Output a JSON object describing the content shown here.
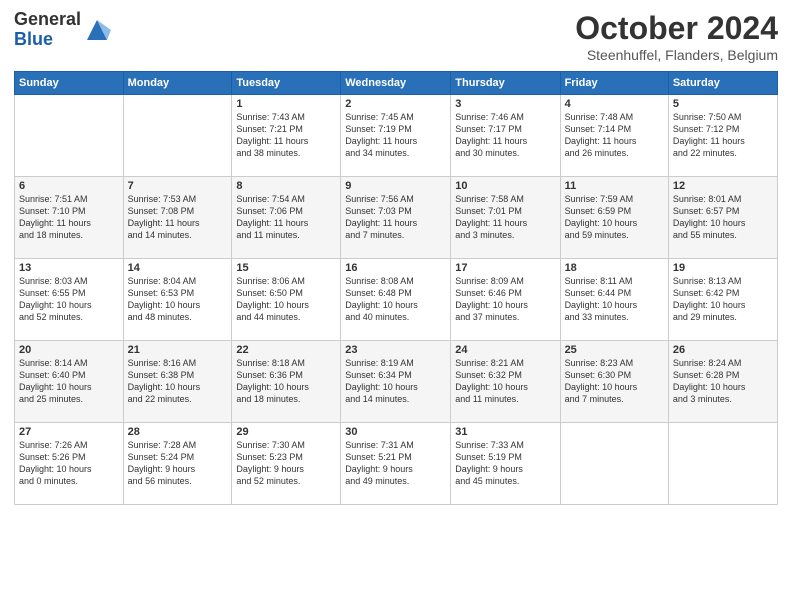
{
  "header": {
    "logo_general": "General",
    "logo_blue": "Blue",
    "title": "October 2024",
    "subtitle": "Steenhuffel, Flanders, Belgium"
  },
  "days_of_week": [
    "Sunday",
    "Monday",
    "Tuesday",
    "Wednesday",
    "Thursday",
    "Friday",
    "Saturday"
  ],
  "weeks": [
    [
      {
        "day": "",
        "info": ""
      },
      {
        "day": "",
        "info": ""
      },
      {
        "day": "1",
        "info": "Sunrise: 7:43 AM\nSunset: 7:21 PM\nDaylight: 11 hours\nand 38 minutes."
      },
      {
        "day": "2",
        "info": "Sunrise: 7:45 AM\nSunset: 7:19 PM\nDaylight: 11 hours\nand 34 minutes."
      },
      {
        "day": "3",
        "info": "Sunrise: 7:46 AM\nSunset: 7:17 PM\nDaylight: 11 hours\nand 30 minutes."
      },
      {
        "day": "4",
        "info": "Sunrise: 7:48 AM\nSunset: 7:14 PM\nDaylight: 11 hours\nand 26 minutes."
      },
      {
        "day": "5",
        "info": "Sunrise: 7:50 AM\nSunset: 7:12 PM\nDaylight: 11 hours\nand 22 minutes."
      }
    ],
    [
      {
        "day": "6",
        "info": "Sunrise: 7:51 AM\nSunset: 7:10 PM\nDaylight: 11 hours\nand 18 minutes."
      },
      {
        "day": "7",
        "info": "Sunrise: 7:53 AM\nSunset: 7:08 PM\nDaylight: 11 hours\nand 14 minutes."
      },
      {
        "day": "8",
        "info": "Sunrise: 7:54 AM\nSunset: 7:06 PM\nDaylight: 11 hours\nand 11 minutes."
      },
      {
        "day": "9",
        "info": "Sunrise: 7:56 AM\nSunset: 7:03 PM\nDaylight: 11 hours\nand 7 minutes."
      },
      {
        "day": "10",
        "info": "Sunrise: 7:58 AM\nSunset: 7:01 PM\nDaylight: 11 hours\nand 3 minutes."
      },
      {
        "day": "11",
        "info": "Sunrise: 7:59 AM\nSunset: 6:59 PM\nDaylight: 10 hours\nand 59 minutes."
      },
      {
        "day": "12",
        "info": "Sunrise: 8:01 AM\nSunset: 6:57 PM\nDaylight: 10 hours\nand 55 minutes."
      }
    ],
    [
      {
        "day": "13",
        "info": "Sunrise: 8:03 AM\nSunset: 6:55 PM\nDaylight: 10 hours\nand 52 minutes."
      },
      {
        "day": "14",
        "info": "Sunrise: 8:04 AM\nSunset: 6:53 PM\nDaylight: 10 hours\nand 48 minutes."
      },
      {
        "day": "15",
        "info": "Sunrise: 8:06 AM\nSunset: 6:50 PM\nDaylight: 10 hours\nand 44 minutes."
      },
      {
        "day": "16",
        "info": "Sunrise: 8:08 AM\nSunset: 6:48 PM\nDaylight: 10 hours\nand 40 minutes."
      },
      {
        "day": "17",
        "info": "Sunrise: 8:09 AM\nSunset: 6:46 PM\nDaylight: 10 hours\nand 37 minutes."
      },
      {
        "day": "18",
        "info": "Sunrise: 8:11 AM\nSunset: 6:44 PM\nDaylight: 10 hours\nand 33 minutes."
      },
      {
        "day": "19",
        "info": "Sunrise: 8:13 AM\nSunset: 6:42 PM\nDaylight: 10 hours\nand 29 minutes."
      }
    ],
    [
      {
        "day": "20",
        "info": "Sunrise: 8:14 AM\nSunset: 6:40 PM\nDaylight: 10 hours\nand 25 minutes."
      },
      {
        "day": "21",
        "info": "Sunrise: 8:16 AM\nSunset: 6:38 PM\nDaylight: 10 hours\nand 22 minutes."
      },
      {
        "day": "22",
        "info": "Sunrise: 8:18 AM\nSunset: 6:36 PM\nDaylight: 10 hours\nand 18 minutes."
      },
      {
        "day": "23",
        "info": "Sunrise: 8:19 AM\nSunset: 6:34 PM\nDaylight: 10 hours\nand 14 minutes."
      },
      {
        "day": "24",
        "info": "Sunrise: 8:21 AM\nSunset: 6:32 PM\nDaylight: 10 hours\nand 11 minutes."
      },
      {
        "day": "25",
        "info": "Sunrise: 8:23 AM\nSunset: 6:30 PM\nDaylight: 10 hours\nand 7 minutes."
      },
      {
        "day": "26",
        "info": "Sunrise: 8:24 AM\nSunset: 6:28 PM\nDaylight: 10 hours\nand 3 minutes."
      }
    ],
    [
      {
        "day": "27",
        "info": "Sunrise: 7:26 AM\nSunset: 5:26 PM\nDaylight: 10 hours\nand 0 minutes."
      },
      {
        "day": "28",
        "info": "Sunrise: 7:28 AM\nSunset: 5:24 PM\nDaylight: 9 hours\nand 56 minutes."
      },
      {
        "day": "29",
        "info": "Sunrise: 7:30 AM\nSunset: 5:23 PM\nDaylight: 9 hours\nand 52 minutes."
      },
      {
        "day": "30",
        "info": "Sunrise: 7:31 AM\nSunset: 5:21 PM\nDaylight: 9 hours\nand 49 minutes."
      },
      {
        "day": "31",
        "info": "Sunrise: 7:33 AM\nSunset: 5:19 PM\nDaylight: 9 hours\nand 45 minutes."
      },
      {
        "day": "",
        "info": ""
      },
      {
        "day": "",
        "info": ""
      }
    ]
  ]
}
